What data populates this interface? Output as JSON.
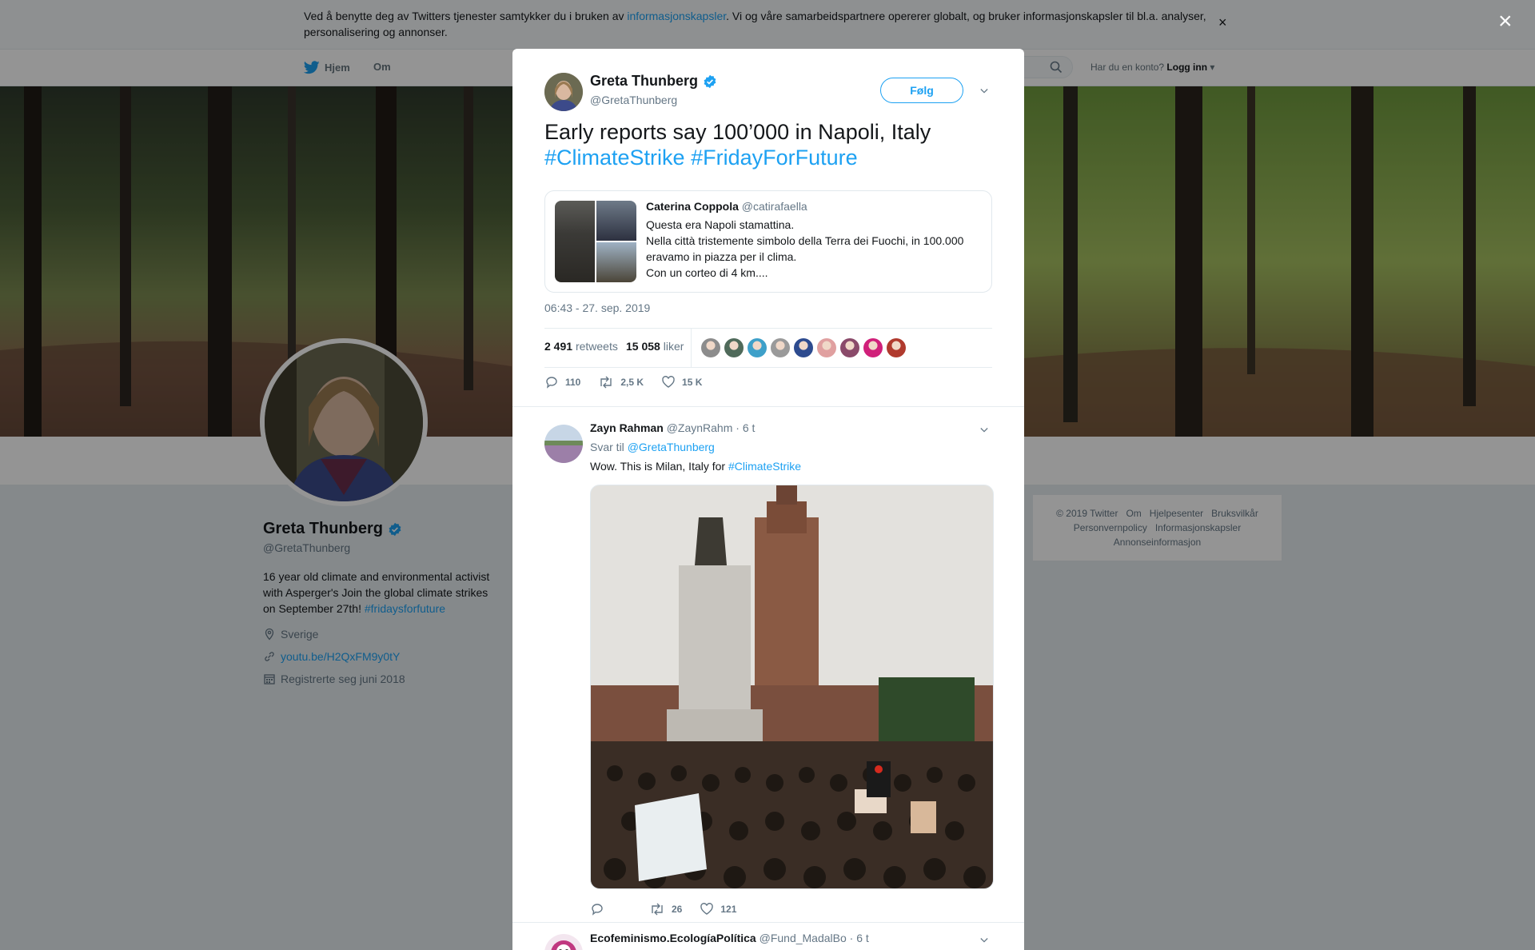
{
  "cookie_bar": {
    "text_before": "Ved å benytte deg av Twitters tjenester samtykker du i bruken av ",
    "link": "informasjonskapsler",
    "text_after": ". Vi og våre samarbeidspartnere opererer globalt, og bruker informasjonskapsler til bl.a. analyser, personalisering og annonser.",
    "close": "×"
  },
  "nav": {
    "home": "Hjem",
    "about": "Om",
    "account_prompt": "Har du en konto?",
    "login": "Logg inn"
  },
  "profile": {
    "name": "Greta Thunberg",
    "handle": "@GretaThunberg",
    "bio_text": "16 year old climate and environmental activist with Asperger's Join the global climate strikes on September 27th! ",
    "bio_hashtag": "#fridaysforfuture",
    "location": "Sverige",
    "url": "youtu.be/H2QxFM9y0tY",
    "joined": "Registrerte seg juni 2018"
  },
  "footer": {
    "links_row1": [
      "© 2019 Twitter",
      "Om",
      "Hjelpesenter",
      "Bruksvilkår"
    ],
    "links_row2": [
      "Personvernpolicy",
      "Informasjonskapsler"
    ],
    "links_row3": [
      "Annonseinformasjon"
    ]
  },
  "overlay_close": "×",
  "tweet": {
    "author_name": "Greta Thunberg",
    "author_handle": "@GretaThunberg",
    "follow_label": "Følg",
    "text": "Early reports say 100’000 in Napoli, Italy ",
    "hashtag1": "#ClimateStrike",
    "hashtag2": "#FridayForFuture",
    "quote": {
      "name": "Caterina Coppola",
      "handle": "@catirafaella",
      "line1": "Questa era Napoli stamattina.",
      "line2": "Nella città tristemente simbolo della Terra dei Fuochi, in 100.000 eravamo in piazza per il clima.",
      "line3": "Con un corteo di 4 km...."
    },
    "timestamp": "06:43 - 27. sep. 2019",
    "retweets_count": "2 491",
    "retweets_label": "retweets",
    "likes_count": "15 058",
    "likes_label": "liker",
    "reply_count": "110",
    "retweet_action_count": "2,5 K",
    "like_action_count": "15 K",
    "liker_colors": [
      "#8c8c8c",
      "#4f6a5a",
      "#3ea0c9",
      "#9a9a9a",
      "#2d4b8f",
      "#e0a0a0",
      "#8a4a6a",
      "#d0207a",
      "#b03a2e"
    ]
  },
  "replies": [
    {
      "name": "Zayn Rahman",
      "handle": "@ZaynRahm",
      "time": "· 6 t",
      "reply_to_label": "Svar til ",
      "reply_to_handle": "@GretaThunberg",
      "text": "Wow. This is Milan, Italy for ",
      "hashtag": "#ClimateStrike",
      "retweets": "26",
      "likes": "121"
    },
    {
      "name": "Ecofeminismo.EcologíaPolítica",
      "handle": "@Fund_MadalBo",
      "time": "· 6 t"
    }
  ],
  "colors": {
    "accent": "#1da1f2",
    "secondary_text": "#657786",
    "verified": "#1da1f2"
  },
  "icons": [
    "twitter-bird-icon",
    "search-icon",
    "verified-badge-icon",
    "chevron-down-icon",
    "reply-icon",
    "retweet-icon",
    "heart-icon",
    "location-icon",
    "link-icon",
    "calendar-icon",
    "close-icon"
  ]
}
